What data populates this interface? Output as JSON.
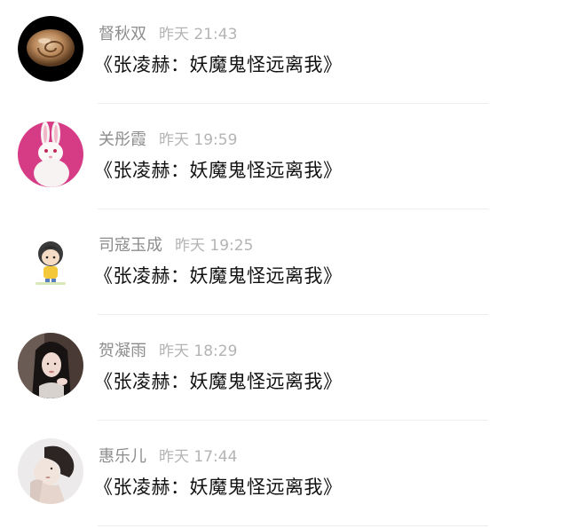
{
  "comments": [
    {
      "name": "督秋双",
      "time": "昨天 21:43",
      "message": "《张凌赫：妖魔鬼怪远离我》",
      "avatar_icon": "snail-shell-avatar"
    },
    {
      "name": "关彤霞",
      "time": "昨天 19:59",
      "message": "《张凌赫：妖魔鬼怪远离我》",
      "avatar_icon": "white-rabbit-avatar"
    },
    {
      "name": "司寇玉成",
      "time": "昨天 19:25",
      "message": "《张凌赫：妖魔鬼怪远离我》",
      "avatar_icon": "cartoon-boy-avatar"
    },
    {
      "name": "贺凝雨",
      "time": "昨天 18:29",
      "message": "《张凌赫：妖魔鬼怪远离我》",
      "avatar_icon": "girl-photo-avatar"
    },
    {
      "name": "惠乐儿",
      "time": "昨天 17:44",
      "message": "《张凌赫：妖魔鬼怪远离我》",
      "avatar_icon": "profile-photo-avatar"
    }
  ]
}
